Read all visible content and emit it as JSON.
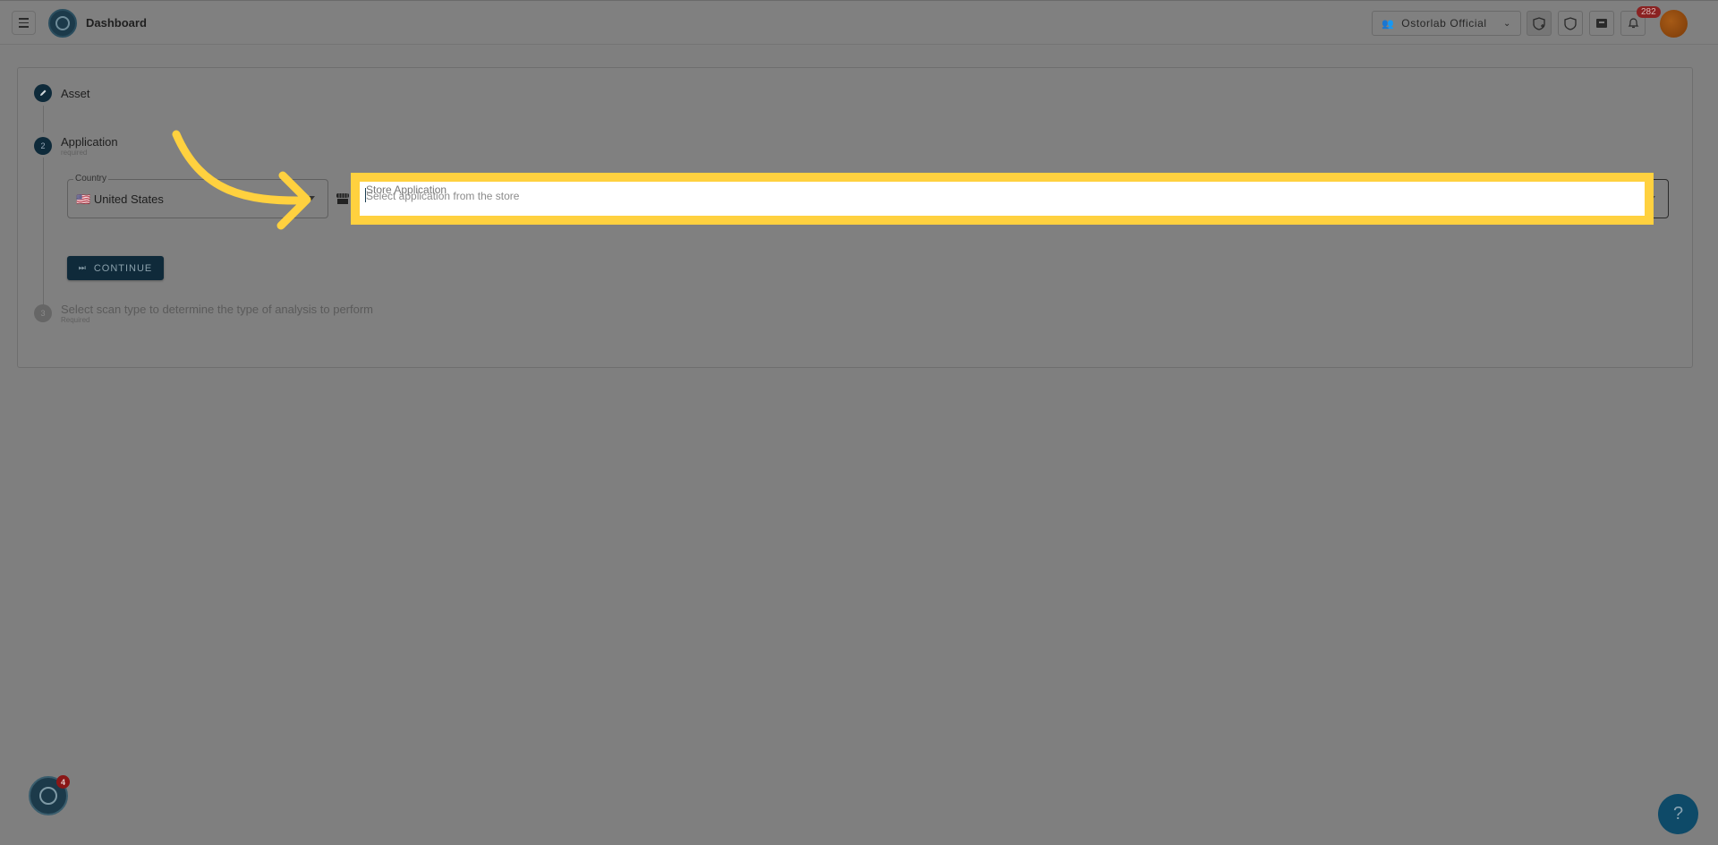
{
  "header": {
    "title": "Dashboard",
    "org_select": {
      "icon": "group-icon",
      "label": "Ostorlab Official",
      "chevron": "chevron-down-icon"
    },
    "icons": [
      "new-scan-icon",
      "shield-icon",
      "ticket-icon",
      "bell-icon"
    ],
    "notifications_count": "282"
  },
  "stepper": {
    "steps": [
      {
        "number": "",
        "icon": "pencil-icon",
        "label": "Asset",
        "sub": ""
      },
      {
        "number": "2",
        "label": "Application",
        "sub": "required"
      },
      {
        "number": "3",
        "label": "Select scan type to determine the type of analysis to perform",
        "sub": "Required"
      }
    ]
  },
  "form": {
    "country": {
      "legend": "Country",
      "flag": "🇺🇸",
      "value": "United States"
    },
    "store_application": {
      "label": "Store Application",
      "placeholder": "Select application from the store",
      "value": ""
    },
    "continue_label": "CONTINUE",
    "continue_icon": "⏭"
  },
  "annotation": {
    "highlight_color": "#ffd13f",
    "arrow_color": "#ffd13f"
  },
  "footer": {
    "bot_badge": "4",
    "help_label": "?"
  }
}
